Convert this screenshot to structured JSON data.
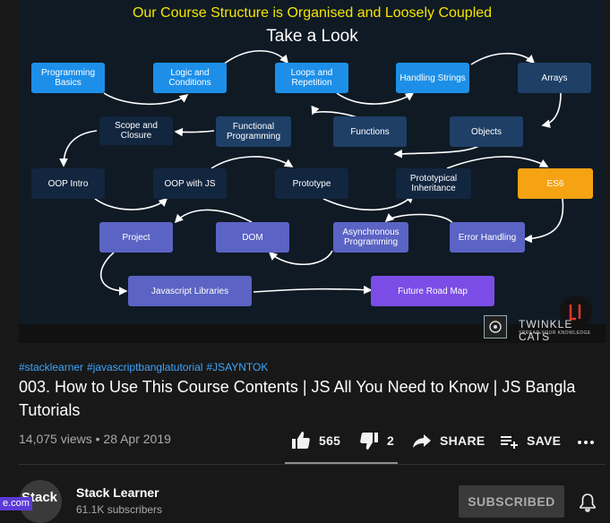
{
  "video": {
    "slide_subtitle": "Our Course Structure is Organised and Loosely Coupled",
    "slide_title": "Take a Look",
    "nodes": {
      "programming_basics": "Programming Basics",
      "logic_conditions": "Logic and Conditions",
      "loops_repetition": "Loops and Repetition",
      "handling_strings": "Handling Strings",
      "arrays": "Arrays",
      "scope_closure": "Scope and Closure",
      "functional_programming": "Functional Programming",
      "functions": "Functions",
      "objects": "Objects",
      "oop_intro": "OOP Intro",
      "oop_with_js": "OOP with JS",
      "prototype": "Prototype",
      "prototypical_inheritance": "Prototypical Inheritance",
      "es6": "ES6",
      "project": "Project",
      "dom": "DOM",
      "async_programming": "Asynchronous Programming",
      "error_handling": "Error Handling",
      "js_libraries": "Javascript Libraries",
      "future_road_map": "Future Road Map"
    },
    "watermark": {
      "name": "TWINKLE CATS",
      "tagline": "SPREAD YOUR KNOWLEDGE"
    }
  },
  "hashtags": [
    "#stacklearner",
    "#javascriptbanglatutorial",
    "#JSAYNTOK"
  ],
  "title": "003. How to Use This Course Contents | JS All You Need to Know | JS Bangla Tutorials",
  "views": "14,075 views",
  "date": "28 Apr 2019",
  "actions": {
    "likes": "565",
    "dislikes": "2",
    "share": "SHARE",
    "save": "SAVE"
  },
  "channel": {
    "name": "Stack Learner",
    "subscribers": "61.1K subscribers",
    "avatar_text": "Stack",
    "subscribe_label": "SUBSCRIBED"
  },
  "url_fragment": "e.com",
  "colors": {
    "link": "#3ea6ff",
    "highlight": "#f5a312",
    "slide_subtitle": "#f5e500"
  },
  "icons": [
    "like-icon",
    "dislike-icon",
    "share-icon",
    "save-icon",
    "more-icon",
    "bell-icon"
  ]
}
